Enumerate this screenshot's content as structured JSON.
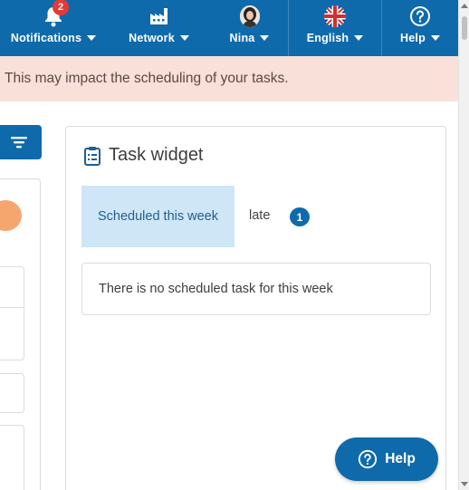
{
  "topnav": {
    "notifications": {
      "label": "Notifications",
      "badge": "2",
      "icon": "bell-icon"
    },
    "network": {
      "label": "Network",
      "icon": "factory-icon"
    },
    "user": {
      "label": "Nina",
      "icon": "avatar"
    },
    "language": {
      "label": "English",
      "icon": "uk-flag-icon"
    },
    "help": {
      "label": "Help",
      "icon": "question-circle-icon"
    }
  },
  "banner": {
    "text": "This may impact the scheduling of your tasks."
  },
  "widget": {
    "title": "Task widget",
    "tabs": {
      "scheduled": "Scheduled this week",
      "late": "late",
      "late_count": "1"
    },
    "empty_message": "There is no scheduled task for this week"
  },
  "help_fab": {
    "label": "Help"
  },
  "colors": {
    "primary": "#0f6aab",
    "banner_bg": "#f9e0d8",
    "tab_active_bg": "#cfe6f6",
    "badge": "#e53935",
    "orange": "#f5a66f"
  }
}
